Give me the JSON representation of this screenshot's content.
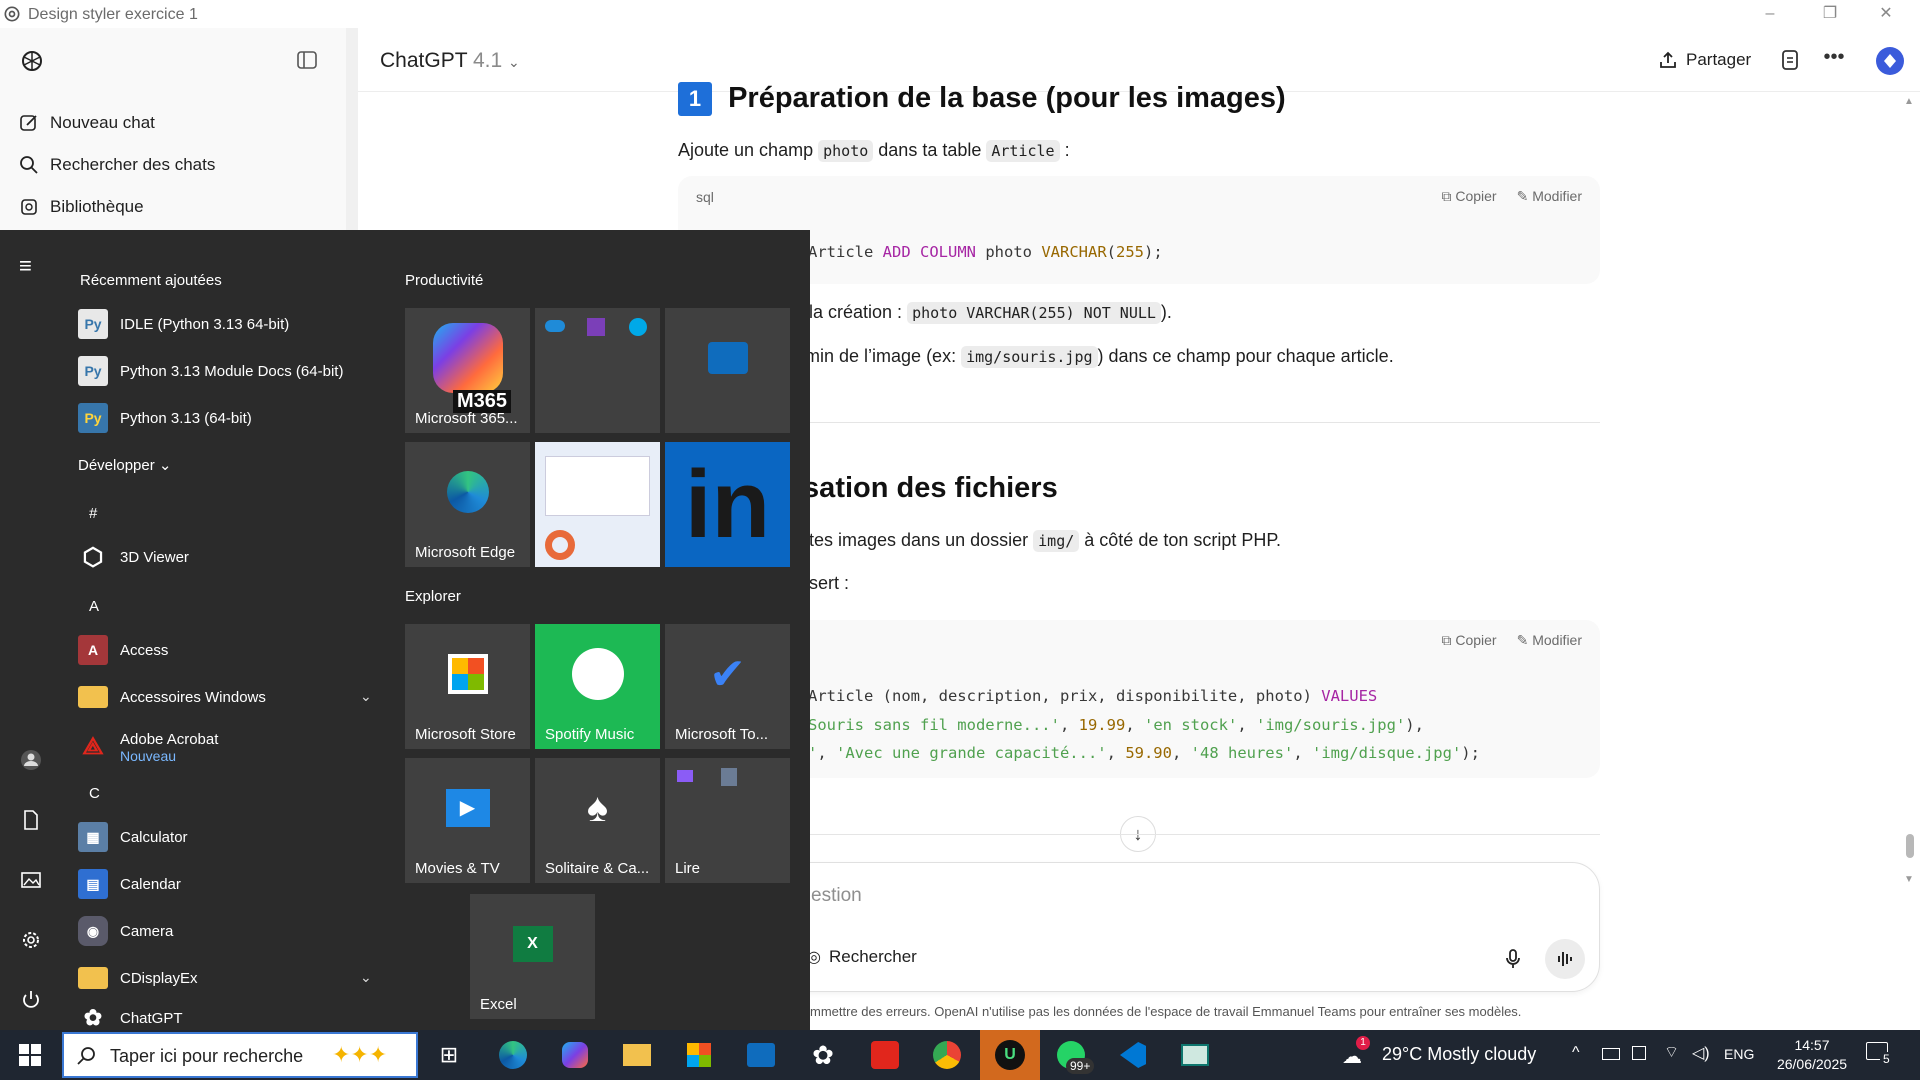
{
  "window": {
    "title": "Design styler exercice 1",
    "minimize": "–",
    "restore": "❐",
    "close": "✕"
  },
  "sidebar": {
    "items": [
      {
        "label": "Nouveau chat",
        "icon": "edit-icon"
      },
      {
        "label": "Rechercher des chats",
        "icon": "search-icon"
      },
      {
        "label": "Bibliothèque",
        "icon": "library-icon"
      }
    ]
  },
  "header": {
    "model": "ChatGPT",
    "version": "4.1",
    "share_label": "Partager"
  },
  "content": {
    "section1": {
      "number": "1",
      "title": "Préparation de la base (pour les images)"
    },
    "p1": {
      "before": "Ajoute un champ",
      "code1": "photo",
      "middle": "dans ta table",
      "code2": "Article",
      "after": ":"
    },
    "code1": {
      "lang": "sql",
      "copy": "Copier",
      "edit": "Modifier",
      "line1_tail": "Article ",
      "kw1": "ADD",
      "kw2": "COLUMN",
      "mid": " photo ",
      "kw3": "VARCHAR",
      "num": "255",
      "end": ");"
    },
    "p2": {
      "visible": "s la création :",
      "code": "photo VARCHAR(255) NOT NULL",
      "after": ")."
    },
    "p3": {
      "visible": "emin de l’image (ex:",
      "code": "img/souris.jpg",
      "after": ") dans ce champ pour chaque article."
    },
    "section2": {
      "title_visible": "isation des fichiers"
    },
    "p4": {
      "visible": "s tes images dans un dossier",
      "code": "img/",
      "after": "à côté de ton script PHP."
    },
    "p5": {
      "visible": "insert :"
    },
    "code2": {
      "copy": "Copier",
      "edit": "Modifier",
      "l1a": "Article (nom, description, prix, disponibilite, photo) ",
      "l1kw": "VALUES",
      "l2s1": "Souris sans fil moderne...'",
      "l2c": ", ",
      "l2n": "19.99",
      "l2c2": ", ",
      "l2s2": "'en stock'",
      "l2c3": ", ",
      "l2s3": "'img/souris.jpg'",
      "l2e": "),",
      "l3s0": "'",
      "l3c0": ", ",
      "l3s1": "'Avec une grande capacité...'",
      "l3c": ", ",
      "l3n": "59.90",
      "l3c2": ", ",
      "l3s2": "'48 heures'",
      "l3c3": ", ",
      "l3s3": "'img/disque.jpg'",
      "l3e": ");"
    }
  },
  "composer": {
    "placeholder": "estion",
    "search_tool": "Rechercher"
  },
  "disclaimer": "mmettre des erreurs. OpenAI n'utilise pas les données de l'espace de travail Emmanuel Teams pour entraîner ses modèles.",
  "start_menu": {
    "recent_title": "Récemment ajoutées",
    "recent": [
      {
        "label": "IDLE (Python 3.13 64-bit)"
      },
      {
        "label": "Python 3.13 Module Docs (64-bit)"
      },
      {
        "label": "Python 3.13 (64-bit)"
      }
    ],
    "develop_label": "Développer",
    "letters": {
      "hash": "#",
      "a": "A",
      "c": "C"
    },
    "apps": {
      "viewer3d": "3D Viewer",
      "access": "Access",
      "accessoires": "Accessoires Windows",
      "acrobat": "Adobe Acrobat",
      "acrobat_sub": "Nouveau",
      "calculator": "Calculator",
      "calendar": "Calendar",
      "camera": "Camera",
      "cdisplay": "CDisplayEx",
      "chatgpt": "ChatGPT"
    },
    "groups": {
      "productivity": "Productivité",
      "explorer": "Explorer"
    },
    "tiles": {
      "m365": "Microsoft 365...",
      "m365_badge": "M365",
      "edge": "Microsoft Edge",
      "store": "Microsoft Store",
      "spotify": "Spotify Music",
      "todo": "Microsoft To...",
      "movies": "Movies & TV",
      "solitaire": "Solitaire & Ca...",
      "lire": "Lire",
      "excel": "Excel"
    }
  },
  "taskbar": {
    "search_placeholder": "Taper ici pour recherche",
    "whatsapp_badge": "99+",
    "weather_badge": "1",
    "weather": "29°C  Mostly cloudy",
    "lang": "ENG",
    "time": "14:57",
    "date": "26/06/2025",
    "notif_count": "5"
  },
  "colors": {
    "accent": "#3b5bdb",
    "start_bg": "#2b2b2b",
    "taskbar_bg": "#1f2631",
    "spotify": "#1db954",
    "linkedin": "#0a66c2"
  }
}
